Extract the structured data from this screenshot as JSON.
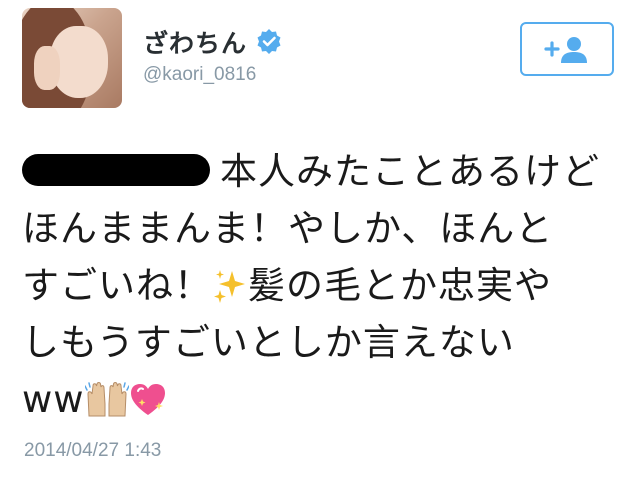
{
  "user": {
    "display_name": "ざわちん",
    "handle": "@kaori_0816"
  },
  "icons": {
    "verified": "verified-badge-icon",
    "follow": "add-person-icon",
    "sparkles": "sparkles-emoji",
    "hands": "raised-hands-emoji",
    "heart": "sparkling-heart-emoji"
  },
  "tweet": {
    "line1": "本人みたことあるけど",
    "line2": "ほんままんま！やしか、ほんと",
    "line3a": "すごいね！",
    "line3b": "髪の毛とか忠実や",
    "line4": "しもうすごいとしか言えない",
    "line5": "ww"
  },
  "timestamp": "2014/04/27 1:43",
  "colors": {
    "accent": "#55acee",
    "verified": "#55acee",
    "muted": "#8899a6"
  }
}
